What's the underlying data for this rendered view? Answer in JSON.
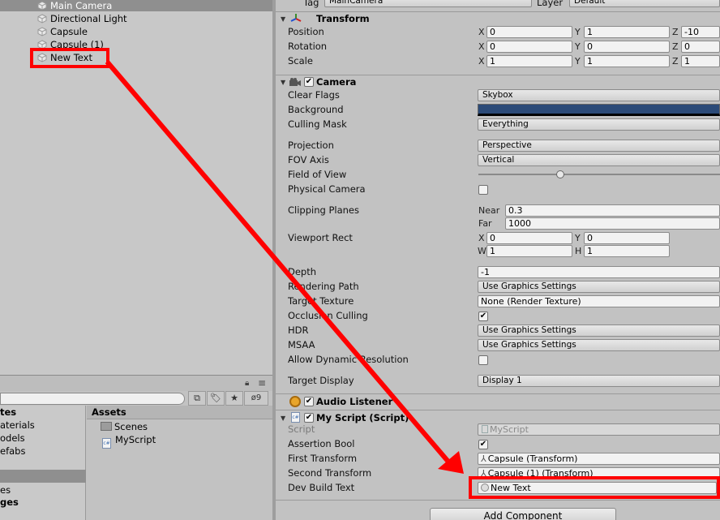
{
  "hierarchy": {
    "items": [
      "Main Camera",
      "Directional Light",
      "Capsule",
      "Capsule (1)",
      "New Text"
    ]
  },
  "project": {
    "badge_count": "9",
    "left_items": [
      "tes",
      "aterials",
      "odels",
      "efabs",
      "es",
      "ges"
    ],
    "assets_header": "Assets",
    "assets": [
      "Scenes",
      "MyScript"
    ]
  },
  "inspector": {
    "tag_label": "Tag",
    "tag_value": "MainCamera",
    "layer_label": "Layer",
    "layer_value": "Default",
    "transform": {
      "title": "Transform",
      "position_label": "Position",
      "rotation_label": "Rotation",
      "scale_label": "Scale",
      "position": {
        "x": "0",
        "y": "1",
        "z": "-10"
      },
      "rotation": {
        "x": "0",
        "y": "0",
        "z": "0"
      },
      "scale": {
        "x": "1",
        "y": "1",
        "z": "1"
      }
    },
    "camera": {
      "title": "Camera",
      "clear_flags_label": "Clear Flags",
      "clear_flags": "Skybox",
      "background_label": "Background",
      "background_color": "#2b4a78",
      "culling_mask_label": "Culling Mask",
      "culling_mask": "Everything",
      "projection_label": "Projection",
      "projection": "Perspective",
      "fov_axis_label": "FOV Axis",
      "fov_axis": "Vertical",
      "field_of_view_label": "Field of View",
      "physical_camera_label": "Physical Camera",
      "clipping_planes_label": "Clipping Planes",
      "near_label": "Near",
      "near": "0.3",
      "far_label": "Far",
      "far": "1000",
      "viewport_rect_label": "Viewport Rect",
      "vp_x": "0",
      "vp_y": "0",
      "vp_w": "1",
      "vp_h": "1",
      "depth_label": "Depth",
      "depth": "-1",
      "rendering_path_label": "Rendering Path",
      "rendering_path": "Use Graphics Settings",
      "target_texture_label": "Target Texture",
      "target_texture": "None (Render Texture)",
      "occlusion_culling_label": "Occlusion Culling",
      "hdr_label": "HDR",
      "hdr": "Use Graphics Settings",
      "msaa_label": "MSAA",
      "msaa": "Use Graphics Settings",
      "allow_dynamic_resolution_label": "Allow Dynamic Resolution",
      "target_display_label": "Target Display",
      "target_display": "Display 1"
    },
    "audio_listener": {
      "title": "Audio Listener"
    },
    "my_script": {
      "title": "My Script (Script)",
      "script_label": "Script",
      "script_value": "MyScript",
      "assertion_bool_label": "Assertion Bool",
      "first_transform_label": "First Transform",
      "first_transform": "Capsule (Transform)",
      "second_transform_label": "Second Transform",
      "second_transform": "Capsule (1) (Transform)",
      "dev_build_text_label": "Dev Build Text",
      "dev_build_text": "New Text"
    },
    "add_component_label": "Add Component"
  },
  "axis": {
    "x": "X",
    "y": "Y",
    "z": "Z",
    "w": "W",
    "h": "H"
  },
  "colors": {
    "annotation": "#ff0000",
    "selected": "#8f8f8f"
  }
}
